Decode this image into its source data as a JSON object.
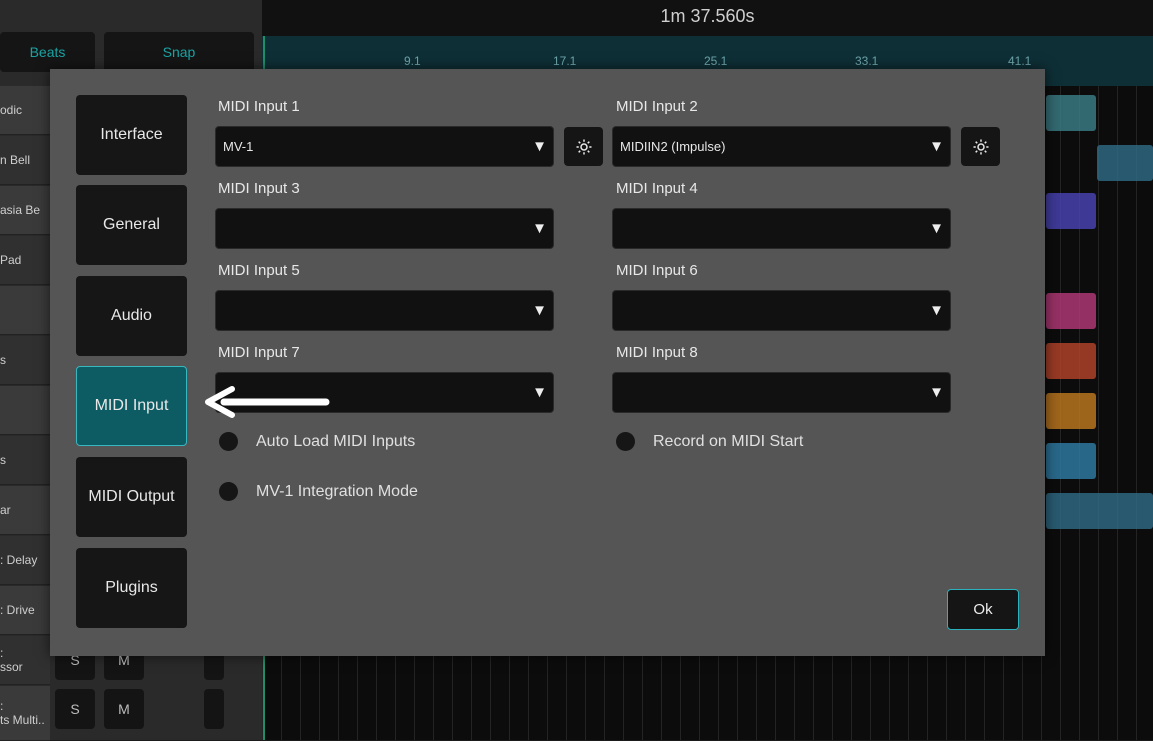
{
  "background": {
    "time_display": "1m 37.560s",
    "beats_label": "Beats",
    "snap_label": "Snap",
    "ruler_marks": [
      "9.1",
      "17.1",
      "25.1",
      "33.1",
      "41.1"
    ],
    "tracks": [
      "odic",
      "n Bell",
      "asia Be",
      "Pad",
      "",
      "s",
      "",
      "s",
      "ar",
      ": Delay",
      ": Drive",
      ":\nssor",
      ":\nts Multi.."
    ],
    "solo_label": "S",
    "mute_label": "M"
  },
  "dialog": {
    "nav": [
      {
        "label": "Interface",
        "active": false
      },
      {
        "label": "General",
        "active": false
      },
      {
        "label": "Audio",
        "active": false
      },
      {
        "label": "MIDI Input",
        "active": true
      },
      {
        "label": "MIDI Output",
        "active": false
      },
      {
        "label": "Plugins",
        "active": false
      }
    ],
    "inputs": [
      {
        "label": "MIDI Input 1",
        "value": "MV-1",
        "has_settings": true
      },
      {
        "label": "MIDI Input 2",
        "value": "MIDIIN2 (Impulse)",
        "has_settings": true
      },
      {
        "label": "MIDI Input 3",
        "value": "",
        "has_settings": false
      },
      {
        "label": "MIDI Input 4",
        "value": "",
        "has_settings": false
      },
      {
        "label": "MIDI Input 5",
        "value": "",
        "has_settings": false
      },
      {
        "label": "MIDI Input 6",
        "value": "",
        "has_settings": false
      },
      {
        "label": "MIDI Input 7",
        "value": "",
        "has_settings": false
      },
      {
        "label": "MIDI Input 8",
        "value": "",
        "has_settings": false
      }
    ],
    "toggles": {
      "auto_load": {
        "label": "Auto Load MIDI Inputs",
        "on": false
      },
      "record_on_start": {
        "label": "Record on MIDI Start",
        "on": false
      },
      "mv1_mode": {
        "label": "MV-1 Integration Mode",
        "on": false
      }
    },
    "ok_label": "Ok",
    "arrow_glyph": "▼"
  },
  "colors": {
    "accent": "#0d5c63",
    "accent_border": "#37b7c0",
    "dialog_bg": "#555555"
  }
}
